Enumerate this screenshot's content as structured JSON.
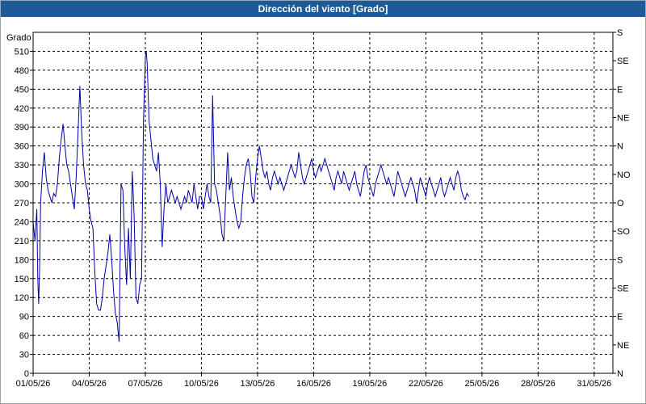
{
  "window": {
    "title": "Dirección del viento [Grado]"
  },
  "chart_data": {
    "type": "line",
    "title": "Dirección del viento [Grado]",
    "ylabel": "Grado",
    "xlabel": "",
    "ylim": [
      0,
      540
    ],
    "yticks": [
      0,
      30,
      60,
      90,
      120,
      150,
      180,
      210,
      240,
      270,
      300,
      330,
      360,
      390,
      420,
      450,
      480,
      510
    ],
    "x_ticks": [
      "01/05/26",
      "04/05/26",
      "07/05/26",
      "10/05/26",
      "13/05/26",
      "16/05/26",
      "19/05/26",
      "22/05/26",
      "25/05/26",
      "28/05/26",
      "31/05/26"
    ],
    "xlim_days": [
      0,
      31
    ],
    "right_axis_labels": [
      "N",
      "NE",
      "E",
      "SE",
      "S",
      "SO",
      "O",
      "NO",
      "N",
      "NE",
      "E",
      "SE",
      "S"
    ],
    "grid": true,
    "line_color": "#0000aa",
    "series": [
      {
        "name": "",
        "points": [
          [
            0.0,
            240
          ],
          [
            0.1,
            210
          ],
          [
            0.2,
            260
          ],
          [
            0.25,
            150
          ],
          [
            0.3,
            110
          ],
          [
            0.35,
            170
          ],
          [
            0.4,
            270
          ],
          [
            0.5,
            320
          ],
          [
            0.6,
            350
          ],
          [
            0.7,
            310
          ],
          [
            0.8,
            290
          ],
          [
            0.9,
            280
          ],
          [
            1.0,
            270
          ],
          [
            1.1,
            285
          ],
          [
            1.2,
            280
          ],
          [
            1.3,
            300
          ],
          [
            1.4,
            340
          ],
          [
            1.5,
            370
          ],
          [
            1.6,
            395
          ],
          [
            1.7,
            360
          ],
          [
            1.8,
            330
          ],
          [
            1.9,
            320
          ],
          [
            2.0,
            300
          ],
          [
            2.1,
            280
          ],
          [
            2.2,
            260
          ],
          [
            2.3,
            310
          ],
          [
            2.4,
            380
          ],
          [
            2.5,
            455
          ],
          [
            2.6,
            380
          ],
          [
            2.7,
            330
          ],
          [
            2.8,
            300
          ],
          [
            2.9,
            290
          ],
          [
            3.0,
            260
          ],
          [
            3.1,
            240
          ],
          [
            3.2,
            230
          ],
          [
            3.3,
            160
          ],
          [
            3.4,
            110
          ],
          [
            3.5,
            100
          ],
          [
            3.6,
            100
          ],
          [
            3.7,
            120
          ],
          [
            3.8,
            150
          ],
          [
            3.9,
            170
          ],
          [
            4.0,
            190
          ],
          [
            4.1,
            220
          ],
          [
            4.2,
            180
          ],
          [
            4.3,
            130
          ],
          [
            4.4,
            95
          ],
          [
            4.5,
            80
          ],
          [
            4.6,
            50
          ],
          [
            4.7,
            300
          ],
          [
            4.8,
            290
          ],
          [
            4.9,
            200
          ],
          [
            5.0,
            140
          ],
          [
            5.1,
            230
          ],
          [
            5.2,
            150
          ],
          [
            5.3,
            320
          ],
          [
            5.4,
            250
          ],
          [
            5.5,
            120
          ],
          [
            5.6,
            110
          ],
          [
            5.7,
            140
          ],
          [
            5.8,
            150
          ],
          [
            5.9,
            400
          ],
          [
            6.0,
            500
          ],
          [
            6.05,
            510
          ],
          [
            6.1,
            490
          ],
          [
            6.2,
            400
          ],
          [
            6.3,
            370
          ],
          [
            6.4,
            340
          ],
          [
            6.5,
            330
          ],
          [
            6.6,
            320
          ],
          [
            6.7,
            350
          ],
          [
            6.8,
            300
          ],
          [
            6.9,
            200
          ],
          [
            7.0,
            260
          ],
          [
            7.1,
            300
          ],
          [
            7.2,
            270
          ],
          [
            7.3,
            280
          ],
          [
            7.4,
            290
          ],
          [
            7.5,
            280
          ],
          [
            7.6,
            270
          ],
          [
            7.7,
            280
          ],
          [
            7.8,
            270
          ],
          [
            7.9,
            260
          ],
          [
            8.0,
            270
          ],
          [
            8.1,
            280
          ],
          [
            8.2,
            270
          ],
          [
            8.3,
            290
          ],
          [
            8.4,
            280
          ],
          [
            8.5,
            270
          ],
          [
            8.6,
            300
          ],
          [
            8.7,
            280
          ],
          [
            8.8,
            260
          ],
          [
            8.9,
            280
          ],
          [
            9.0,
            280
          ],
          [
            9.1,
            260
          ],
          [
            9.2,
            280
          ],
          [
            9.3,
            300
          ],
          [
            9.4,
            280
          ],
          [
            9.5,
            270
          ],
          [
            9.6,
            440
          ],
          [
            9.7,
            300
          ],
          [
            9.8,
            290
          ],
          [
            9.9,
            270
          ],
          [
            10.0,
            250
          ],
          [
            10.1,
            220
          ],
          [
            10.2,
            210
          ],
          [
            10.3,
            280
          ],
          [
            10.4,
            350
          ],
          [
            10.5,
            290
          ],
          [
            10.6,
            310
          ],
          [
            10.7,
            280
          ],
          [
            10.8,
            260
          ],
          [
            10.9,
            240
          ],
          [
            11.0,
            230
          ],
          [
            11.1,
            240
          ],
          [
            11.2,
            280
          ],
          [
            11.3,
            310
          ],
          [
            11.4,
            330
          ],
          [
            11.5,
            340
          ],
          [
            11.6,
            320
          ],
          [
            11.7,
            280
          ],
          [
            11.8,
            270
          ],
          [
            11.9,
            310
          ],
          [
            12.0,
            340
          ],
          [
            12.1,
            360
          ],
          [
            12.2,
            340
          ],
          [
            12.3,
            320
          ],
          [
            12.4,
            310
          ],
          [
            12.5,
            320
          ],
          [
            12.6,
            300
          ],
          [
            12.7,
            290
          ],
          [
            12.8,
            310
          ],
          [
            12.9,
            320
          ],
          [
            13.0,
            310
          ],
          [
            13.1,
            300
          ],
          [
            13.2,
            310
          ],
          [
            13.3,
            300
          ],
          [
            13.4,
            290
          ],
          [
            13.5,
            300
          ],
          [
            13.6,
            310
          ],
          [
            13.7,
            320
          ],
          [
            13.8,
            330
          ],
          [
            13.9,
            320
          ],
          [
            14.0,
            310
          ],
          [
            14.1,
            320
          ],
          [
            14.2,
            350
          ],
          [
            14.3,
            330
          ],
          [
            14.4,
            310
          ],
          [
            14.5,
            300
          ],
          [
            14.6,
            310
          ],
          [
            14.7,
            320
          ],
          [
            14.8,
            330
          ],
          [
            14.9,
            340
          ],
          [
            15.0,
            320
          ],
          [
            15.1,
            310
          ],
          [
            15.2,
            320
          ],
          [
            15.3,
            330
          ],
          [
            15.4,
            320
          ],
          [
            15.5,
            330
          ],
          [
            15.6,
            340
          ],
          [
            15.7,
            330
          ],
          [
            15.8,
            320
          ],
          [
            15.9,
            310
          ],
          [
            16.0,
            300
          ],
          [
            16.1,
            290
          ],
          [
            16.2,
            310
          ],
          [
            16.3,
            320
          ],
          [
            16.4,
            310
          ],
          [
            16.5,
            300
          ],
          [
            16.6,
            320
          ],
          [
            16.7,
            310
          ],
          [
            16.8,
            300
          ],
          [
            16.9,
            290
          ],
          [
            17.0,
            300
          ],
          [
            17.1,
            310
          ],
          [
            17.2,
            320
          ],
          [
            17.3,
            300
          ],
          [
            17.4,
            290
          ],
          [
            17.5,
            280
          ],
          [
            17.6,
            300
          ],
          [
            17.7,
            320
          ],
          [
            17.8,
            330
          ],
          [
            17.9,
            310
          ],
          [
            18.0,
            300
          ],
          [
            18.1,
            290
          ],
          [
            18.2,
            280
          ],
          [
            18.3,
            300
          ],
          [
            18.4,
            310
          ],
          [
            18.5,
            320
          ],
          [
            18.6,
            330
          ],
          [
            18.7,
            320
          ],
          [
            18.8,
            310
          ],
          [
            18.9,
            300
          ],
          [
            19.0,
            310
          ],
          [
            19.1,
            300
          ],
          [
            19.2,
            290
          ],
          [
            19.3,
            280
          ],
          [
            19.4,
            300
          ],
          [
            19.5,
            320
          ],
          [
            19.6,
            310
          ],
          [
            19.7,
            300
          ],
          [
            19.8,
            290
          ],
          [
            19.9,
            280
          ],
          [
            20.0,
            290
          ],
          [
            20.1,
            300
          ],
          [
            20.2,
            310
          ],
          [
            20.3,
            300
          ],
          [
            20.4,
            290
          ],
          [
            20.5,
            270
          ],
          [
            20.6,
            290
          ],
          [
            20.7,
            310
          ],
          [
            20.8,
            300
          ],
          [
            20.9,
            290
          ],
          [
            21.0,
            280
          ],
          [
            21.1,
            300
          ],
          [
            21.2,
            310
          ],
          [
            21.3,
            300
          ],
          [
            21.4,
            290
          ],
          [
            21.5,
            280
          ],
          [
            21.6,
            290
          ],
          [
            21.7,
            300
          ],
          [
            21.8,
            310
          ],
          [
            21.9,
            290
          ],
          [
            22.0,
            280
          ],
          [
            22.1,
            290
          ],
          [
            22.2,
            300
          ],
          [
            22.3,
            310
          ],
          [
            22.4,
            300
          ],
          [
            22.5,
            290
          ],
          [
            22.6,
            310
          ],
          [
            22.7,
            320
          ],
          [
            22.8,
            310
          ],
          [
            22.9,
            290
          ],
          [
            23.0,
            280
          ],
          [
            23.1,
            275
          ],
          [
            23.2,
            285
          ],
          [
            23.3,
            280
          ]
        ]
      }
    ]
  }
}
